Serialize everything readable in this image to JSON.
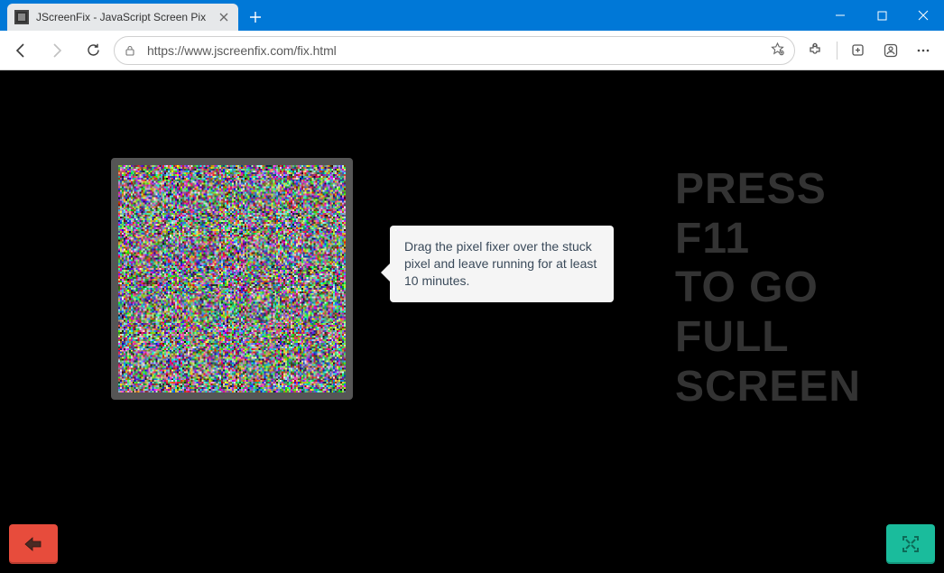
{
  "browser": {
    "tab_title": "JScreenFix - JavaScript Screen Pix",
    "url": "https://www.jscreenfix.com/fix.html",
    "nav": {
      "back": "Back",
      "forward": "Forward",
      "refresh": "Refresh"
    },
    "toolbar_icons": {
      "lock": "lock-icon",
      "favorite": "favorite-icon",
      "extensions": "extensions-icon",
      "collections": "collections-icon",
      "profile": "profile-icon",
      "menu": "menu-icon"
    },
    "window_controls": {
      "minimize": "Minimize",
      "maximize": "Maximize",
      "close": "Close"
    }
  },
  "page": {
    "tooltip_text": "Drag the pixel fixer over the stuck pixel and leave running for at least 10 minutes.",
    "fullscreen_hint": "PRESS F11 TO GO FULL SCREEN",
    "buttons": {
      "back": "Go back",
      "fullscreen": "Enter fullscreen"
    },
    "colors": {
      "back_button": "#e74c3c",
      "fullscreen_button": "#1abc9c",
      "heading": "#333333",
      "tooltip_bg": "#f5f5f5",
      "fixer_border": "#555555"
    }
  }
}
